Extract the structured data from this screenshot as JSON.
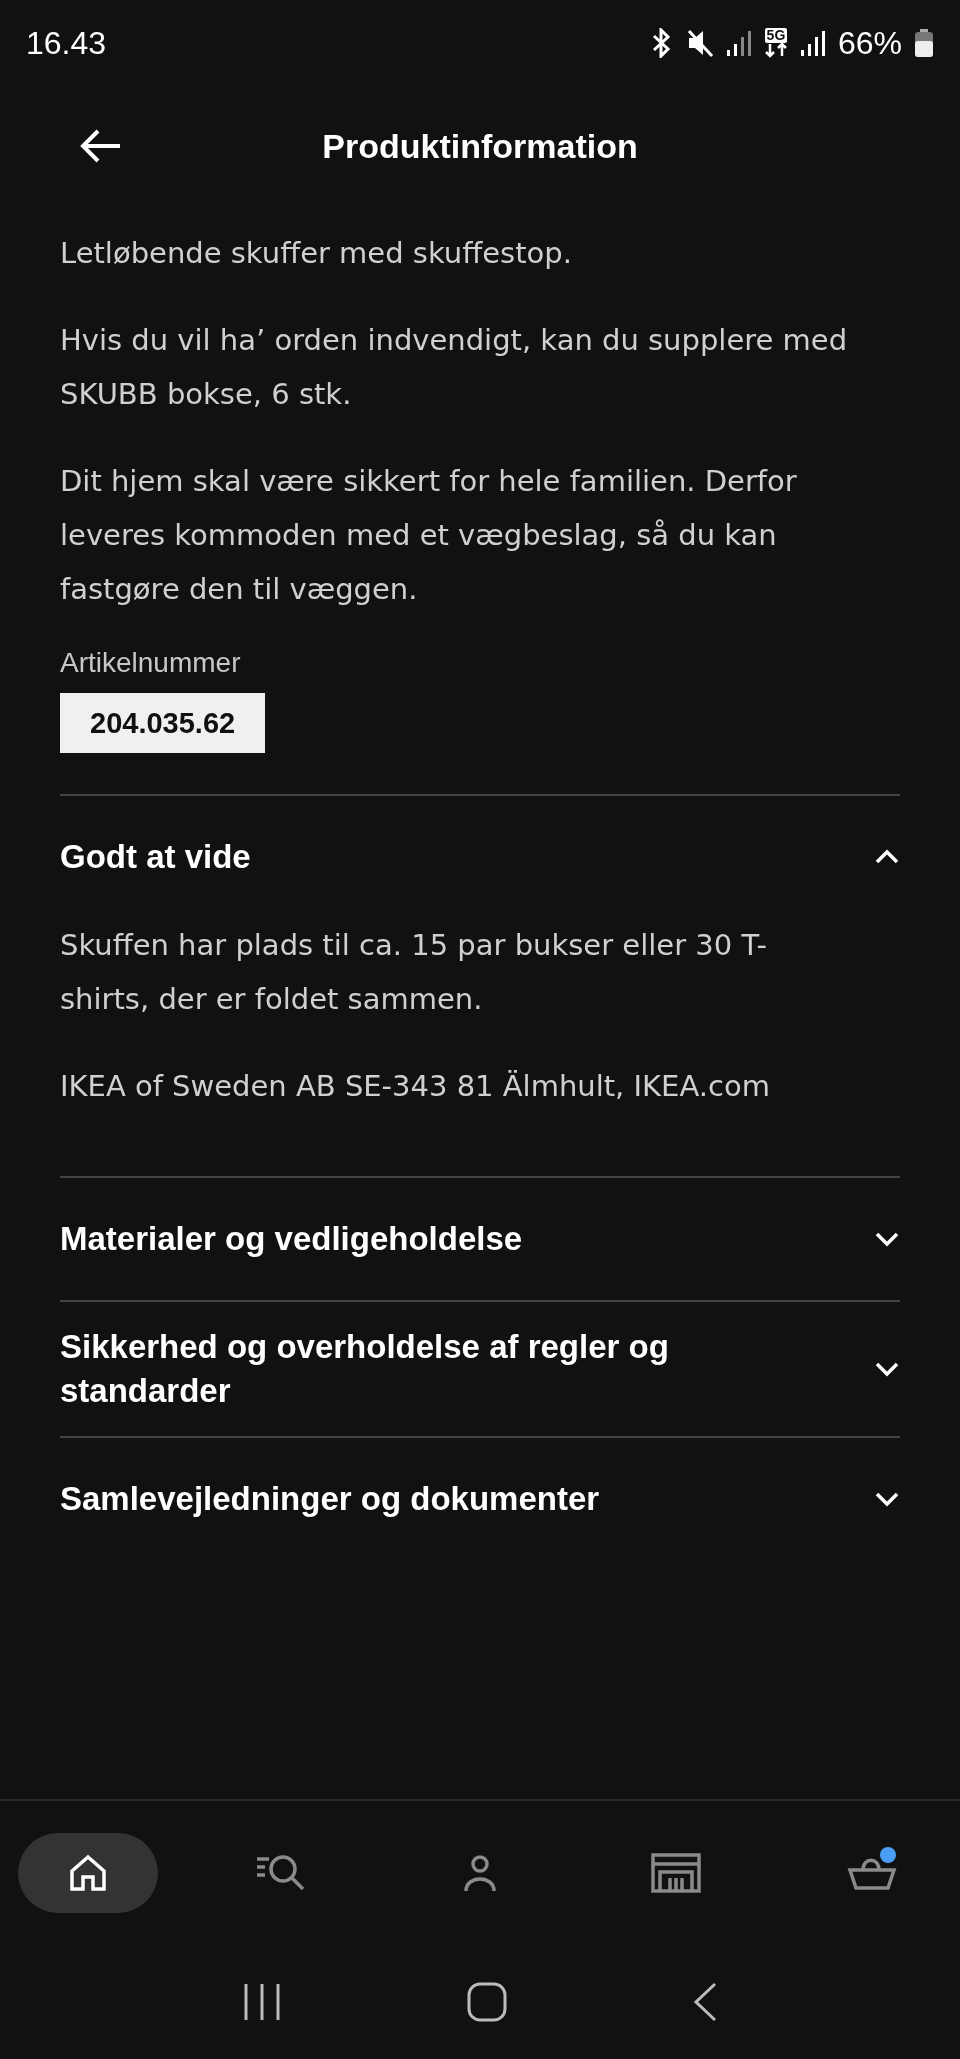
{
  "status_bar": {
    "time": "16.43",
    "network": "5G",
    "battery": "66%"
  },
  "header": {
    "title": "Produktinformation"
  },
  "paragraphs": [
    "Letløbende skuffer med skuffestop.",
    "Hvis du vil ha’ orden indvendigt, kan du supplere med SKUBB bokse, 6 stk.",
    "Dit hjem skal være sikkert for hele familien. Derfor leveres kommoden med et vægbeslag, så du kan fastgøre den til væggen."
  ],
  "article": {
    "label": "Artikelnummer",
    "number": "204.035.62"
  },
  "sections": [
    {
      "title": "Godt at vide",
      "expanded": true,
      "paragraphs": [
        "Skuffen har plads til ca. 15 par bukser eller 30 T-shirts, der er foldet sammen.",
        "IKEA of Sweden AB SE-343 81 Älmhult, IKEA.com"
      ]
    },
    {
      "title": "Materialer og vedligeholdelse",
      "expanded": false
    },
    {
      "title": "Sikkerhed og overholdelse af regler og standarder",
      "expanded": false
    },
    {
      "title": "Samlevejledninger og dokumenter",
      "expanded": false
    }
  ],
  "bottom_nav": [
    {
      "kind": "home",
      "selected": true
    },
    {
      "kind": "search",
      "selected": false
    },
    {
      "kind": "profile",
      "selected": false
    },
    {
      "kind": "store",
      "selected": false
    },
    {
      "kind": "cart",
      "selected": false,
      "color": "#4a9ff5"
    }
  ]
}
